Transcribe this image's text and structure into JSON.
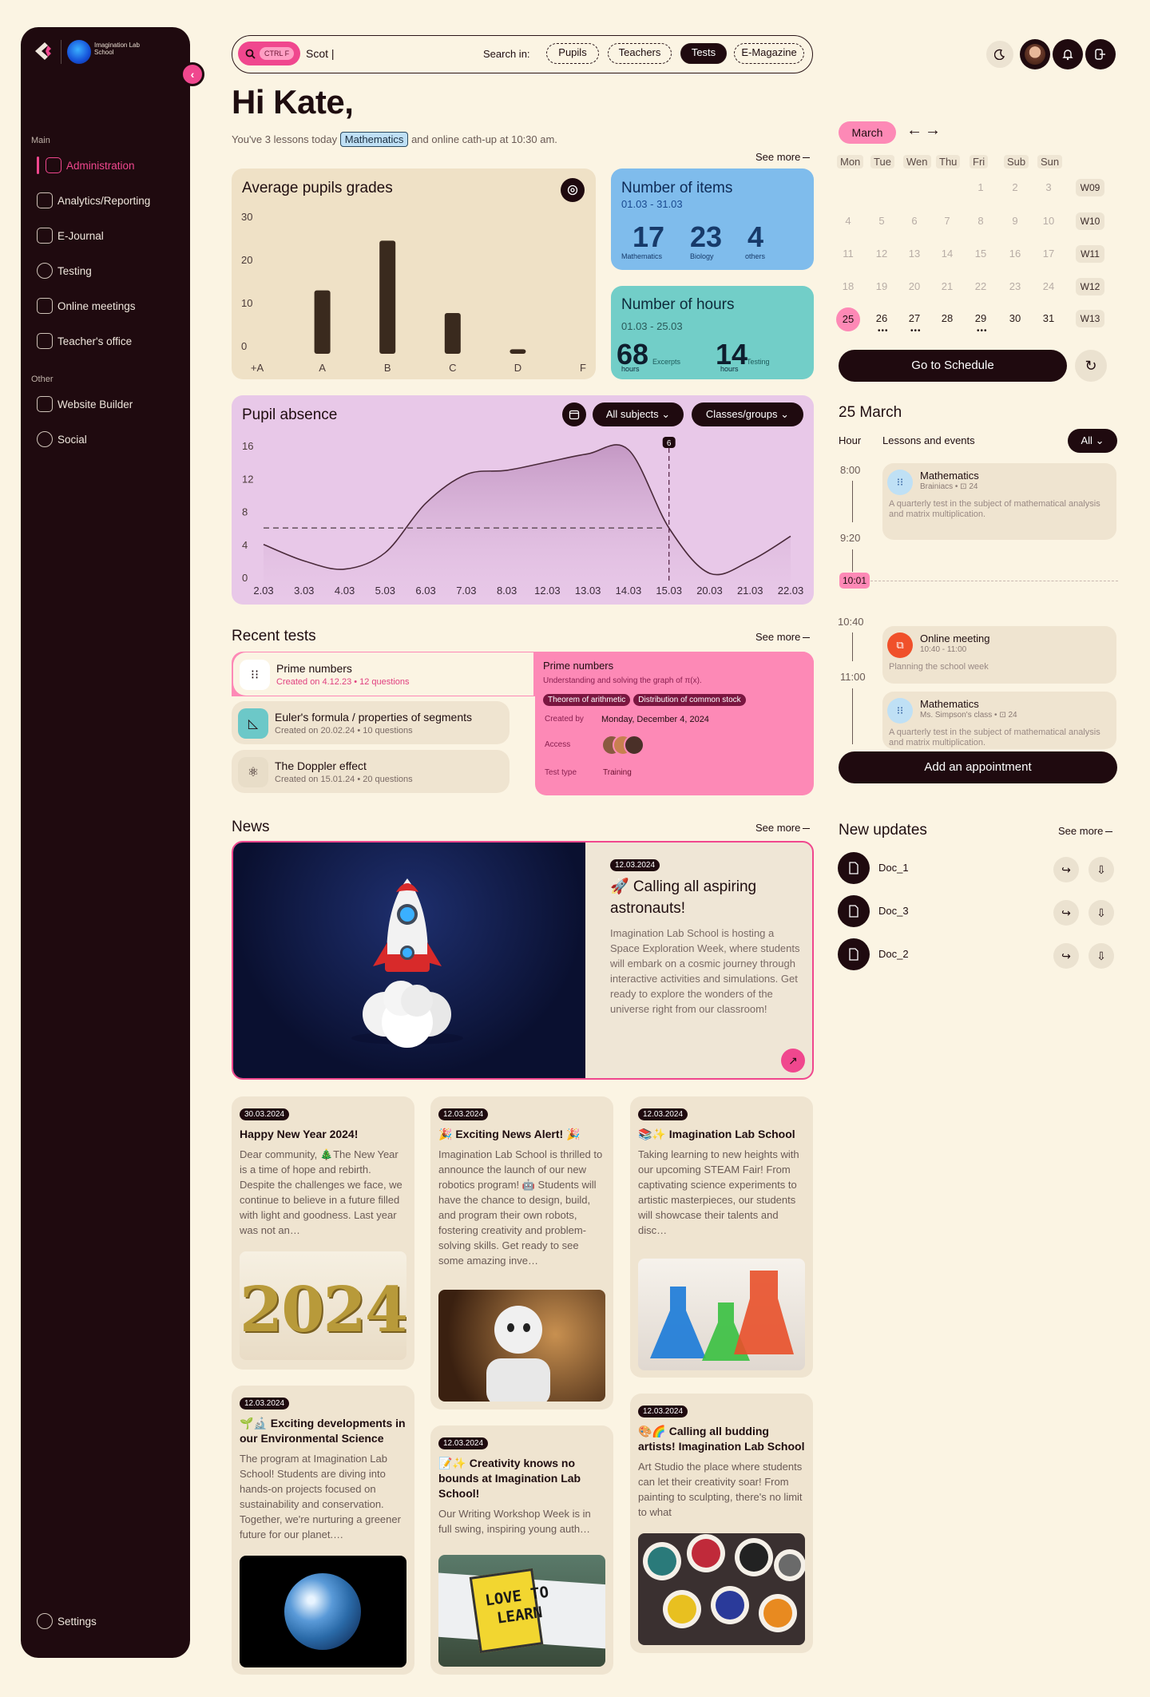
{
  "sidebar": {
    "school_name": "Imagination Lab School",
    "section_main": "Main",
    "section_other": "Other",
    "items": [
      {
        "label": "Administration"
      },
      {
        "label": "Analytics/Reporting"
      },
      {
        "label": "E-Journal"
      },
      {
        "label": "Testing"
      },
      {
        "label": "Online meetings"
      },
      {
        "label": "Teacher's office"
      },
      {
        "label": "Website Builder"
      },
      {
        "label": "Social"
      }
    ],
    "settings": "Settings"
  },
  "search": {
    "shortcut": "CTRL F",
    "value": "Scot |",
    "search_in": "Search in:",
    "filters": [
      "Pupils",
      "Teachers",
      "Tests",
      "E-Magazine"
    ],
    "selected": "Tests"
  },
  "greeting": {
    "title": "Hi Kate,",
    "pre": "You've 3 lessons today",
    "tag": "Mathematics",
    "post": "and online cath-up at 10:30 am."
  },
  "see_more": "See more",
  "grades": {
    "title": "Average pupils grades",
    "yticks": [
      "30",
      "20",
      "10",
      "0"
    ],
    "categories": [
      "+A",
      "A",
      "B",
      "C",
      "D",
      "F"
    ]
  },
  "items": {
    "title": "Number of items",
    "range": "01.03 - 31.03",
    "stats": [
      {
        "value": "17",
        "label": "Mathematics"
      },
      {
        "value": "23",
        "label": "Biology"
      },
      {
        "value": "4",
        "label": "others"
      }
    ]
  },
  "hours": {
    "title": "Number of hours",
    "range": "01.03 - 25.03",
    "stats": [
      {
        "value": "68",
        "unit": "hours",
        "label": "Excerpts"
      },
      {
        "value": "14",
        "unit": "hours",
        "label": "Testing"
      }
    ]
  },
  "absence": {
    "title": "Pupil absence",
    "filter_subjects": "All subjects",
    "filter_classes": "Classes/groups",
    "yticks": [
      "16",
      "12",
      "8",
      "4",
      "0"
    ],
    "marker_label": "6"
  },
  "chart_data": [
    {
      "type": "bar",
      "title": "Average pupils grades",
      "categories": [
        "+A",
        "A",
        "B",
        "C",
        "D",
        "F"
      ],
      "values": [
        0,
        14,
        25,
        9,
        1,
        0
      ],
      "ylim": [
        0,
        30
      ]
    },
    {
      "type": "area",
      "title": "Pupil absence",
      "x": [
        "2.03",
        "3.03",
        "4.03",
        "5.03",
        "6.03",
        "7.03",
        "8.03",
        "12.03",
        "13.03",
        "14.03",
        "15.03",
        "20.03",
        "21.03",
        "22.03"
      ],
      "values": [
        4,
        2,
        1,
        3,
        9,
        12.5,
        13,
        14,
        15,
        15.5,
        6,
        0.5,
        2,
        5
      ],
      "ylim": [
        0,
        16
      ],
      "average": 6
    }
  ],
  "recent_tests": {
    "title": "Recent tests",
    "rows": [
      {
        "name": "Prime numbers",
        "meta": "Created on 4.12.23 • 12 questions"
      },
      {
        "name": "Euler's formula / properties of segments",
        "meta": "Created on 20.02.24 • 10 questions"
      },
      {
        "name": "The Doppler effect",
        "meta": "Created on 15.01.24 • 20 questions"
      }
    ],
    "detail": {
      "name": "Prime numbers",
      "desc": "Understanding and solving the graph of π(x).",
      "chips": [
        "Theorem of arithmetic",
        "Distribution of common stock"
      ],
      "created_by_label": "Created by",
      "created_by": "Monday, December 4, 2024",
      "access_label": "Access",
      "type_label": "Test type",
      "type": "Training"
    }
  },
  "news": {
    "title": "News",
    "feature": {
      "date": "12.03.2024",
      "title": "🚀 Calling all aspiring astronauts!",
      "body": "Imagination Lab School is hosting a Space Exploration Week, where students will embark on a cosmic journey through interactive activities and simulations. Get ready to explore the wonders of the universe right from our classroom!"
    },
    "cards": [
      {
        "date": "30.03.2024",
        "title": "Happy New Year 2024!",
        "body": "Dear community, 🎄The New Year is a time of hope and rebirth. Despite the challenges we face, we continue to believe in a future filled with light and goodness. Last year was not an…"
      },
      {
        "date": "12.03.2024",
        "title": "🎉 Exciting News Alert! 🎉",
        "body": "Imagination Lab School is thrilled to announce the launch of our new robotics program! 🤖 Students will have the chance to design, build, and program their own robots, fostering creativity and problem-solving skills. Get ready to see some amazing inve…"
      },
      {
        "date": "12.03.2024",
        "title": "📚✨ Imagination Lab School",
        "body": "Taking learning to new heights with our upcoming STEAM Fair! From captivating science experiments to artistic masterpieces, our students will showcase their talents and disc…"
      },
      {
        "date": "12.03.2024",
        "title": "🌱🔬 Exciting developments in our Environmental Science",
        "body": "The program at Imagination Lab School! Students are diving into hands-on projects focused on sustainability and conservation. Together, we're nurturing a greener future for our planet.…"
      },
      {
        "date": "12.03.2024",
        "title": "📝✨ Creativity knows no bounds at Imagination Lab School!",
        "body": "Our Writing Workshop Week is in full swing, inspiring young auth…"
      },
      {
        "date": "12.03.2024",
        "title": "🎨🌈 Calling all budding artists! Imagination Lab School",
        "body": "Art Studio the place where students can let their creativity soar! From painting to sculpting, there's no limit to what"
      }
    ],
    "sign_text_1": "LOVE TO",
    "sign_text_2": "LEARN",
    "year_text": "2024"
  },
  "calendar": {
    "month": "March",
    "days": [
      "Mon",
      "Tue",
      "Wen",
      "Thu",
      "Fri",
      "Sub",
      "Sun"
    ],
    "weeks": [
      {
        "label": "W09",
        "dates": [
          "",
          "",
          "",
          "",
          "1",
          "2",
          "3"
        ]
      },
      {
        "label": "W10",
        "dates": [
          "4",
          "5",
          "6",
          "7",
          "8",
          "9",
          "10"
        ]
      },
      {
        "label": "W11",
        "dates": [
          "11",
          "12",
          "13",
          "14",
          "15",
          "16",
          "17"
        ]
      },
      {
        "label": "W12",
        "dates": [
          "18",
          "19",
          "20",
          "21",
          "22",
          "23",
          "24"
        ]
      },
      {
        "label": "W13",
        "dates": [
          "25",
          "26",
          "27",
          "28",
          "29",
          "30",
          "31"
        ]
      }
    ],
    "today": "25",
    "schedule_button": "Go to Schedule"
  },
  "day": {
    "title": "25 March",
    "hour_col": "Hour",
    "events_col": "Lessons and events",
    "filter": "All",
    "times": [
      "8:00",
      "9:20",
      "10:40",
      "11:00"
    ],
    "now": "10:01",
    "events": [
      {
        "title": "Mathematics",
        "sub": "Brainiacs • ⊡ 24",
        "desc": "A quarterly test in the subject of mathematical analysis and matrix multiplication."
      },
      {
        "title": "Online meeting",
        "sub": "10:40 - 11:00",
        "desc": "Planning the school week"
      },
      {
        "title": "Mathematics",
        "sub": "Ms. Simpson's class • ⊡ 24",
        "desc": "A quarterly test in the subject of mathematical analysis and matrix multiplication."
      }
    ],
    "add_button": "Add an appointment"
  },
  "updates": {
    "title": "New updates",
    "docs": [
      "Doc_1",
      "Doc_3",
      "Doc_2"
    ]
  }
}
